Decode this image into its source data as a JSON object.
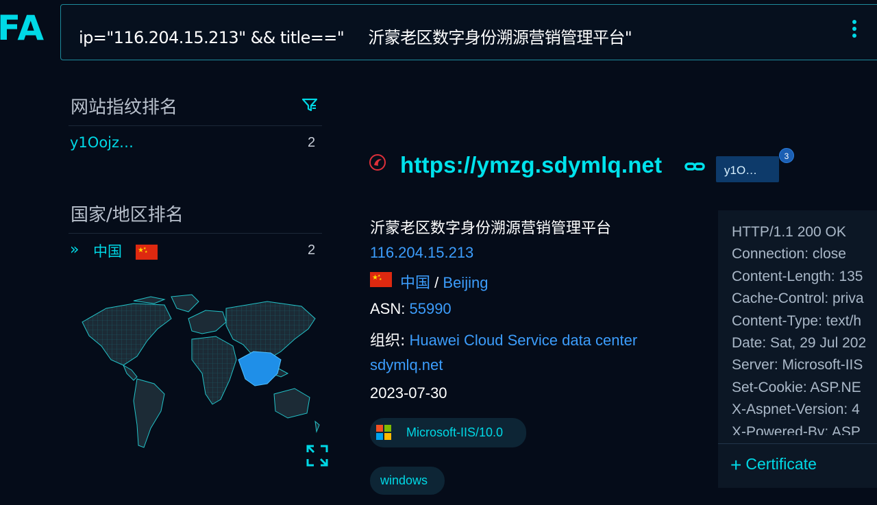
{
  "logo": {
    "text": "FA"
  },
  "search": {
    "query": "ip=\"116.204.15.213\" && title==\"     沂蒙老区数字身份溯源营销管理平台\""
  },
  "sidebar": {
    "fingerprint": {
      "title": "网站指纹排名",
      "items": [
        {
          "label": "y1Oojz…",
          "count": "2"
        }
      ]
    },
    "country": {
      "title": "国家/地区排名",
      "items": [
        {
          "prefix": "»",
          "label": "中国",
          "count": "2"
        }
      ]
    }
  },
  "result": {
    "url": "https://ymzg.sdymlq.net",
    "tag": "y1O…",
    "tag_badge": "3",
    "title": "沂蒙老区数字身份溯源营销管理平台",
    "ip": "116.204.15.213",
    "country": "中国",
    "separator": "/",
    "city": "Beijing",
    "asn_label": "ASN:",
    "asn": "55990",
    "org_label": "组织:",
    "org": "Huawei Cloud Service data center",
    "domain": "sdymlq.net",
    "date": "2023-07-30",
    "server_pill": "Microsoft-IIS/10.0",
    "os_pill": "windows"
  },
  "http_response": {
    "lines": [
      "HTTP/1.1 200 OK",
      "Connection: close",
      "Content-Length: 135",
      "Cache-Control: priva",
      "Content-Type: text/h",
      "Date: Sat, 29 Jul 202",
      "Server: Microsoft-IIS",
      "Set-Cookie: ASP.NE",
      "X-Aspnet-Version: 4",
      "X-Powered-By: ASP"
    ],
    "certificate_label": "Certificate",
    "certificate_prefix": "+"
  },
  "colors": {
    "accent": "#00d9e6",
    "link": "#3c9dfc",
    "background": "#050c19"
  },
  "icons": [
    "filter-icon",
    "kebab-menu-icon",
    "chevrons-right-icon",
    "china-flag-icon",
    "world-map",
    "expand-icon",
    "site-favicon",
    "link-icon",
    "windows-logo-icon"
  ]
}
